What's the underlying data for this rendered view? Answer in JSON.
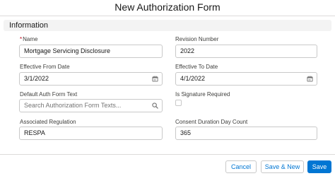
{
  "modal": {
    "title": "New Authorization Form"
  },
  "section": {
    "title": "Information"
  },
  "fields": {
    "name": {
      "label": "Name",
      "required_mark": "*",
      "value": "Mortgage Servicing Disclosure"
    },
    "revision_number": {
      "label": "Revision Number",
      "value": "2022"
    },
    "effective_from_date": {
      "label": "Effective From Date",
      "value": "3/1/2022",
      "icon": "calendar-icon"
    },
    "effective_to_date": {
      "label": "Effective To Date",
      "value": "4/1/2022",
      "icon": "calendar-icon"
    },
    "default_auth_form_text": {
      "label": "Default Auth Form Text",
      "placeholder": "Search Authorization Form Texts...",
      "icon": "search-icon"
    },
    "is_signature_required": {
      "label": "Is Signature Required",
      "checked": false
    },
    "associated_regulation": {
      "label": "Associated Regulation",
      "value": "RESPA"
    },
    "consent_duration_day_count": {
      "label": "Consent Duration Day Count",
      "value": "365"
    }
  },
  "footer": {
    "cancel_label": "Cancel",
    "save_new_label": "Save & New",
    "save_label": "Save"
  },
  "colors": {
    "brand": "#0176d3",
    "required": "#ba0517",
    "border": "#c9c9c9",
    "section_bg": "#f3f3f3"
  }
}
